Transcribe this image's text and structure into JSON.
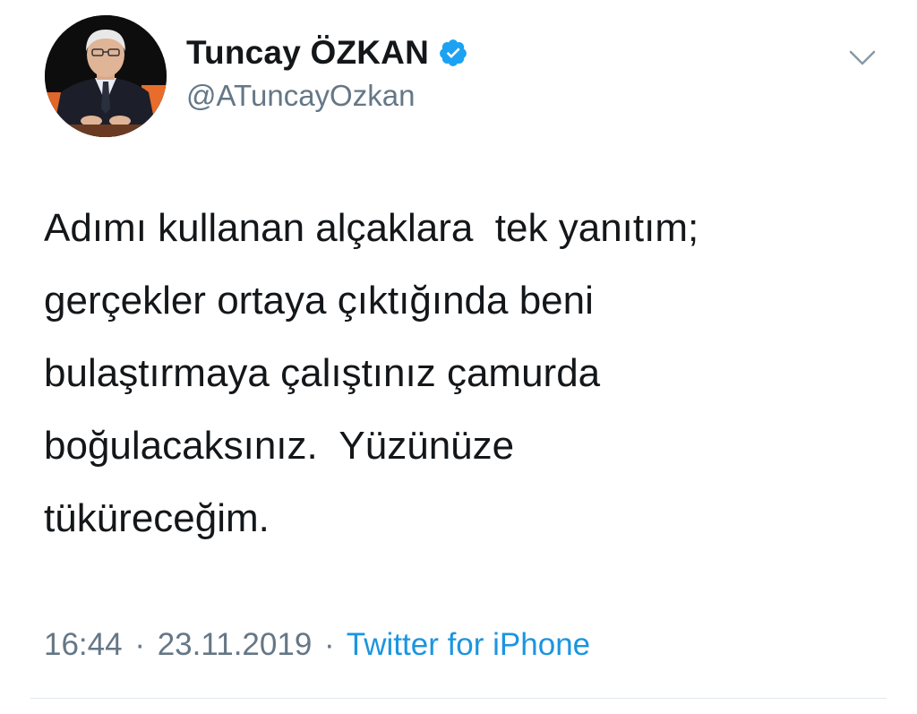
{
  "tweet": {
    "author": {
      "display_name": "Tuncay ÖZKAN",
      "handle": "@ATuncayOzkan",
      "verified": true,
      "avatar": "profile-photo"
    },
    "text": "Adımı kullanan alçaklara  tek yanıtım;\ngerçekler ortaya çıktığında beni\nbulaştırmaya çalıştınız çamurda\nboğulacaksınız.  Yüzünüze\ntüküreceğim.",
    "time": "16:44",
    "date": "23.11.2019",
    "separator": "·",
    "source": "Twitter for iPhone"
  },
  "icons": {
    "verified": "verified-badge-icon",
    "menu": "chevron-down-icon"
  },
  "colors": {
    "accent": "#1b95e0",
    "secondary_text": "#657786",
    "primary_text": "#14171a",
    "divider": "#e1e8ed"
  }
}
